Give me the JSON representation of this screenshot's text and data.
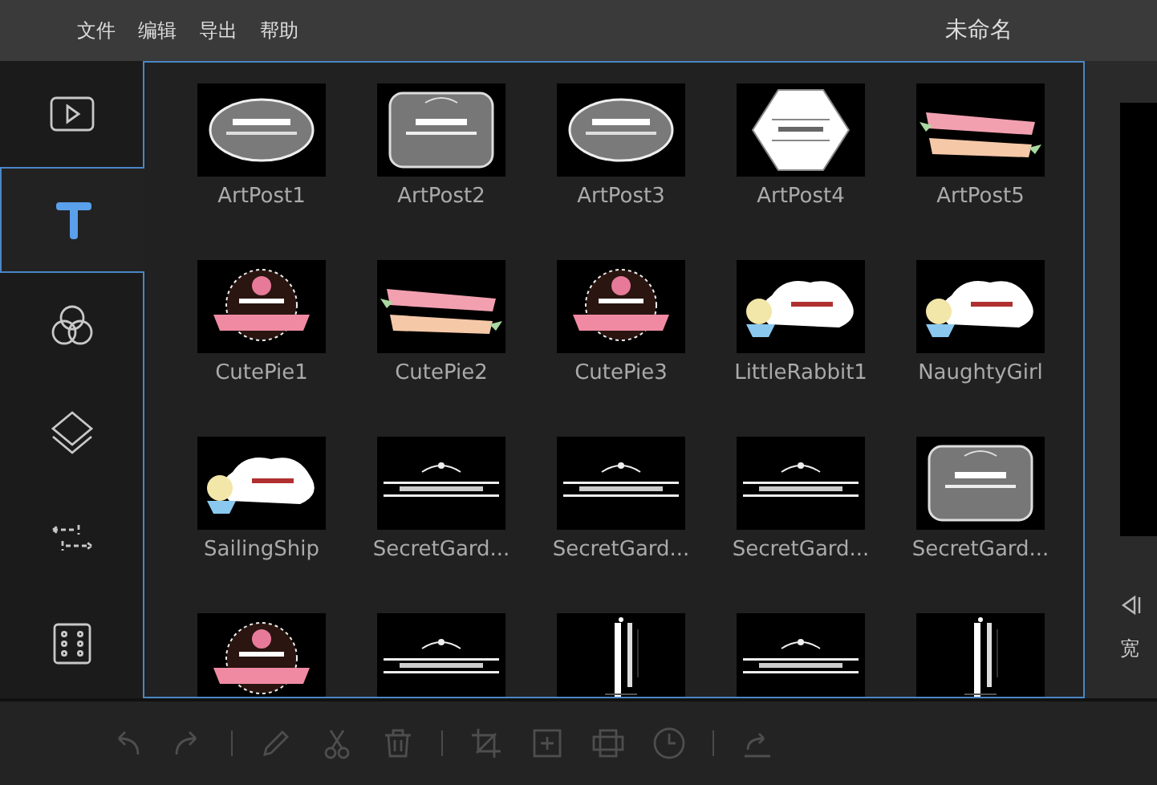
{
  "menu": [
    "文件",
    "编辑",
    "导出",
    "帮助"
  ],
  "title": "未命名",
  "tabs": [
    {
      "kind": "video",
      "selected": false
    },
    {
      "kind": "text",
      "selected": true
    },
    {
      "kind": "filter",
      "selected": false
    },
    {
      "kind": "overlay",
      "selected": false
    },
    {
      "kind": "transition",
      "selected": false
    },
    {
      "kind": "film",
      "selected": false
    }
  ],
  "templates": [
    {
      "name": "ArtPost1",
      "kind": "oval"
    },
    {
      "name": "ArtPost2",
      "kind": "frame"
    },
    {
      "name": "ArtPost3",
      "kind": "oval"
    },
    {
      "name": "ArtPost4",
      "kind": "hexagon"
    },
    {
      "name": "ArtPost5",
      "kind": "ribbon"
    },
    {
      "name": "CutePie1",
      "kind": "circle"
    },
    {
      "name": "CutePie2",
      "kind": "ribbon"
    },
    {
      "name": "CutePie3",
      "kind": "circle"
    },
    {
      "name": "LittleRabbit1",
      "kind": "cloud"
    },
    {
      "name": "NaughtyGirl",
      "kind": "cloud"
    },
    {
      "name": "SailingShip",
      "kind": "cloud"
    },
    {
      "name": "SecretGard...",
      "kind": "rule"
    },
    {
      "name": "SecretGard...",
      "kind": "rule"
    },
    {
      "name": "SecretGard...",
      "kind": "rule"
    },
    {
      "name": "SecretGard...",
      "kind": "frame"
    },
    {
      "kind": "circle"
    },
    {
      "kind": "rule"
    },
    {
      "kind": "vertical"
    },
    {
      "kind": "rule"
    },
    {
      "kind": "vertical"
    }
  ],
  "side_panel": {
    "label": "宽"
  },
  "toolbar": [
    {
      "kind": "undo",
      "disabled": true
    },
    {
      "kind": "redo",
      "disabled": true
    },
    {
      "kind": "separator"
    },
    {
      "kind": "pencil",
      "disabled": true
    },
    {
      "kind": "scissors",
      "disabled": true
    },
    {
      "kind": "trash",
      "disabled": true
    },
    {
      "kind": "separator"
    },
    {
      "kind": "crop",
      "disabled": true
    },
    {
      "kind": "frame",
      "disabled": true
    },
    {
      "kind": "grid",
      "disabled": true
    },
    {
      "kind": "clock",
      "disabled": true
    },
    {
      "kind": "separator"
    },
    {
      "kind": "share",
      "disabled": true
    }
  ]
}
